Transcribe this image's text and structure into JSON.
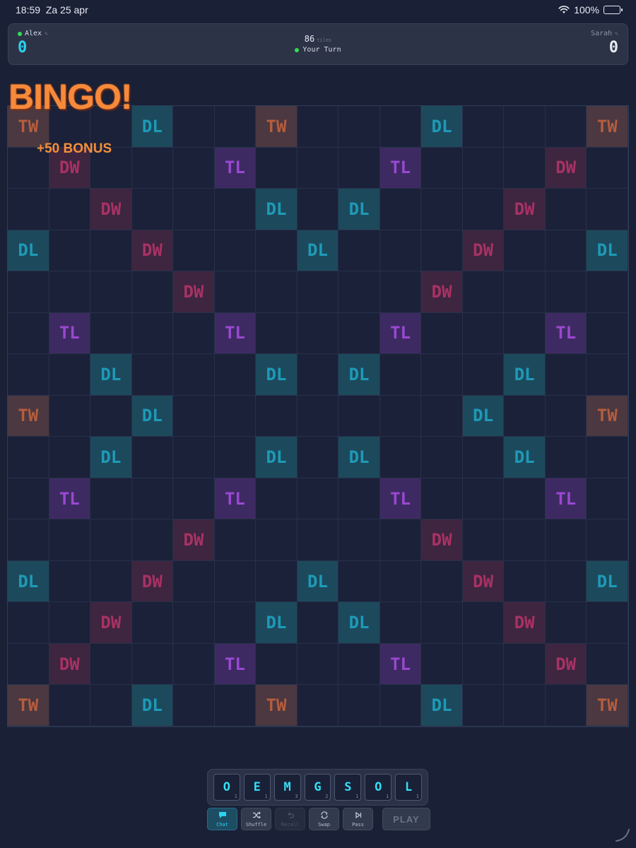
{
  "status": {
    "time": "18:59",
    "date": "Za 25 apr",
    "battery": "100%",
    "battery_level": 1.0
  },
  "players": {
    "left": {
      "name": "Alex",
      "score": "0",
      "online": true
    },
    "right": {
      "name": "Sarah",
      "score": "0"
    }
  },
  "game": {
    "tiles_left": "86",
    "tiles_label": "tiles",
    "turn": "Your Turn"
  },
  "overlay": {
    "bingo": "BINGO!",
    "bonus": "+50 BONUS"
  },
  "board": {
    "rows": [
      [
        "TW",
        "",
        "",
        "DL",
        "",
        "",
        "TW",
        "",
        "",
        "",
        "DL",
        "",
        "",
        "",
        "TW"
      ],
      [
        "",
        "DW",
        "",
        "",
        "",
        "TL",
        "",
        "",
        "",
        "TL",
        "",
        "",
        "",
        "DW",
        ""
      ],
      [
        "",
        "",
        "DW",
        "",
        "",
        "",
        "DL",
        "",
        "DL",
        "",
        "",
        "",
        "DW",
        "",
        ""
      ],
      [
        "DL",
        "",
        "",
        "DW",
        "",
        "",
        "",
        "DL",
        "",
        "",
        "",
        "DW",
        "",
        "",
        "DL"
      ],
      [
        "",
        "",
        "",
        "",
        "DW",
        "",
        "",
        "",
        "",
        "",
        "DW",
        "",
        "",
        "",
        ""
      ],
      [
        "",
        "TL",
        "",
        "",
        "",
        "TL",
        "",
        "",
        "",
        "TL",
        "",
        "",
        "",
        "TL",
        ""
      ],
      [
        "",
        "",
        "DL",
        "",
        "",
        "",
        "DL",
        "",
        "DL",
        "",
        "",
        "",
        "DL",
        "",
        ""
      ],
      [
        "TW",
        "",
        "",
        "DL",
        "",
        "",
        "",
        "",
        "",
        "",
        "",
        "DL",
        "",
        "",
        "TW"
      ],
      [
        "",
        "",
        "DL",
        "",
        "",
        "",
        "DL",
        "",
        "DL",
        "",
        "",
        "",
        "DL",
        "",
        ""
      ],
      [
        "",
        "TL",
        "",
        "",
        "",
        "TL",
        "",
        "",
        "",
        "TL",
        "",
        "",
        "",
        "TL",
        ""
      ],
      [
        "",
        "",
        "",
        "",
        "DW",
        "",
        "",
        "",
        "",
        "",
        "DW",
        "",
        "",
        "",
        ""
      ],
      [
        "DL",
        "",
        "",
        "DW",
        "",
        "",
        "",
        "DL",
        "",
        "",
        "",
        "DW",
        "",
        "",
        "DL"
      ],
      [
        "",
        "",
        "DW",
        "",
        "",
        "",
        "DL",
        "",
        "DL",
        "",
        "",
        "",
        "DW",
        "",
        ""
      ],
      [
        "",
        "DW",
        "",
        "",
        "",
        "TL",
        "",
        "",
        "",
        "TL",
        "",
        "",
        "",
        "DW",
        ""
      ],
      [
        "TW",
        "",
        "",
        "DL",
        "",
        "",
        "TW",
        "",
        "",
        "",
        "DL",
        "",
        "",
        "",
        "TW"
      ]
    ]
  },
  "rack": [
    {
      "letter": "O",
      "points": "1"
    },
    {
      "letter": "E",
      "points": "1"
    },
    {
      "letter": "M",
      "points": "3"
    },
    {
      "letter": "G",
      "points": "2"
    },
    {
      "letter": "S",
      "points": "1"
    },
    {
      "letter": "O",
      "points": "1"
    },
    {
      "letter": "L",
      "points": "1"
    }
  ],
  "controls": [
    {
      "key": "chat",
      "label": "Chat",
      "icon": "chat-icon",
      "state": "active"
    },
    {
      "key": "shuffle",
      "label": "Shuffle",
      "icon": "shuffle-icon",
      "state": "normal"
    },
    {
      "key": "recall",
      "label": "Recall",
      "icon": "undo-icon",
      "state": "disabled"
    },
    {
      "key": "swap",
      "label": "Swap",
      "icon": "refresh-icon",
      "state": "normal"
    },
    {
      "key": "pass",
      "label": "Pass",
      "icon": "skip-icon",
      "state": "normal"
    }
  ],
  "play_label": "PLAY",
  "colors": {
    "accent": "#2ad3f0",
    "bingo": "#f78a3a",
    "online": "#33dd55"
  }
}
